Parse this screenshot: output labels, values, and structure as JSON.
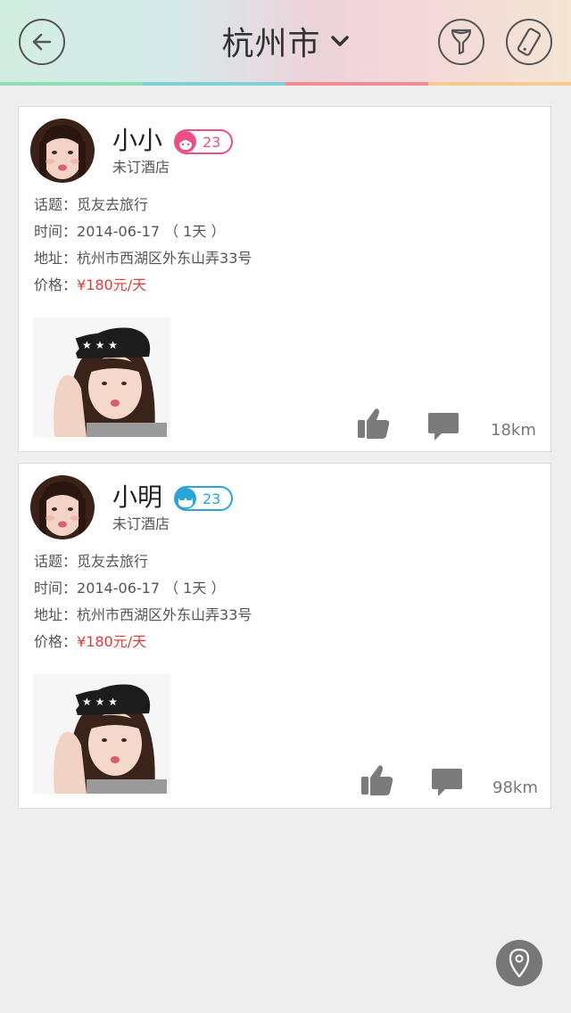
{
  "header": {
    "title": "杭州市",
    "stripe_colors": [
      "#8fdcb8",
      "#7fcfd6",
      "#ef8c96",
      "#f6c98e"
    ],
    "icons": {
      "back": "back-arrow-icon",
      "title_dropdown": "chevron-down-icon",
      "filter": "filter-funnel-icon",
      "phone": "phone-icon"
    }
  },
  "cards": [
    {
      "name": "小小",
      "gender": "female",
      "age": "23",
      "badge_color": "#ee4e86",
      "status": "未订酒店",
      "topic_label": "话题：",
      "topic": "觅友去旅行",
      "time_label": "时间：",
      "time": "2014-06-17 （ 1天 ）",
      "address_label": "地址：",
      "address": "杭州市西湖区外东山弄33号",
      "price_label": "价格：",
      "price": "¥180元/天",
      "distance": "18km"
    },
    {
      "name": "小明",
      "gender": "male",
      "age": "23",
      "badge_color": "#2aa5d8",
      "status": "未订酒店",
      "topic_label": "话题：",
      "topic": "觅友去旅行",
      "time_label": "时间：",
      "time": "2014-06-17 （ 1天 ）",
      "address_label": "地址：",
      "address": "杭州市西湖区外东山弄33号",
      "price_label": "价格：",
      "price": "¥180元/天",
      "distance": "98km"
    }
  ],
  "colors": {
    "price": "#e33a3a",
    "background": "#eeeeee",
    "location_button": "#777777"
  },
  "floating": {
    "icon": "location-pin-icon"
  }
}
